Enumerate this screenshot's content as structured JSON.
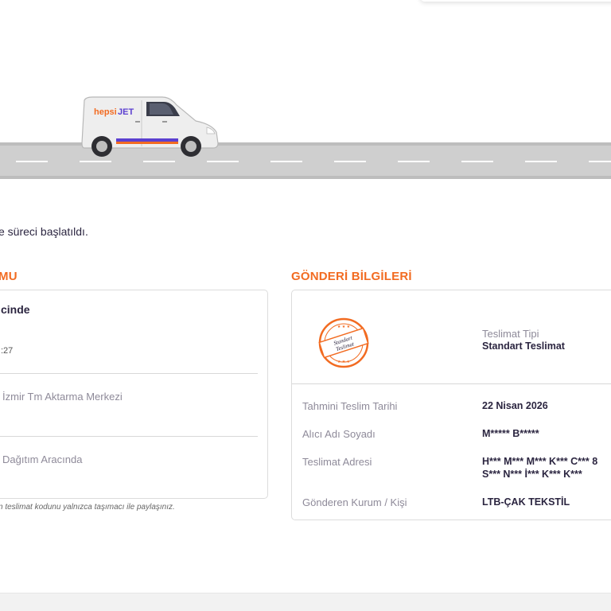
{
  "status_message": "e süreci başlatıldı.",
  "tracking_section": {
    "title": "MU",
    "current_status": "cinde",
    "current_time": ":27",
    "history": [
      "İzmir Tm Aktarma Merkezi",
      "Dağıtım Aracında"
    ],
    "note": "n teslimat kodunu yalnızca taşımacı ile paylaşınız."
  },
  "shipment_section": {
    "title": "GÖNDERİ BİLGİLERİ",
    "delivery_type_label": "Teslimat Tipi",
    "delivery_type_value": "Standart Teslimat",
    "stamp_text": "Standart Teslimat",
    "rows": [
      {
        "label": "Tahmini Teslim Tarihi",
        "value": "22 Nisan 2026"
      },
      {
        "label": "Alıcı Adı Soyadı",
        "value": "M***** B*****"
      },
      {
        "label": "Teslimat Adresi",
        "value": "H*** M*** M*** K*** C*** 8",
        "value2": "S*** N*** İ*** K*** K***"
      },
      {
        "label": "Gönderen Kurum / Kişi",
        "value": "LTB-ÇAK TEKSTİL"
      }
    ]
  },
  "van_brand": {
    "part1": "hepsi",
    "part2": "JET"
  },
  "colors": {
    "accent": "#f26b21",
    "brand_blue": "#5b3fd0",
    "text_dark": "#2b2540",
    "text_muted": "#8e8a99"
  },
  "icons": [
    "delivery-van-icon",
    "standart-teslimat-stamp-icon"
  ]
}
